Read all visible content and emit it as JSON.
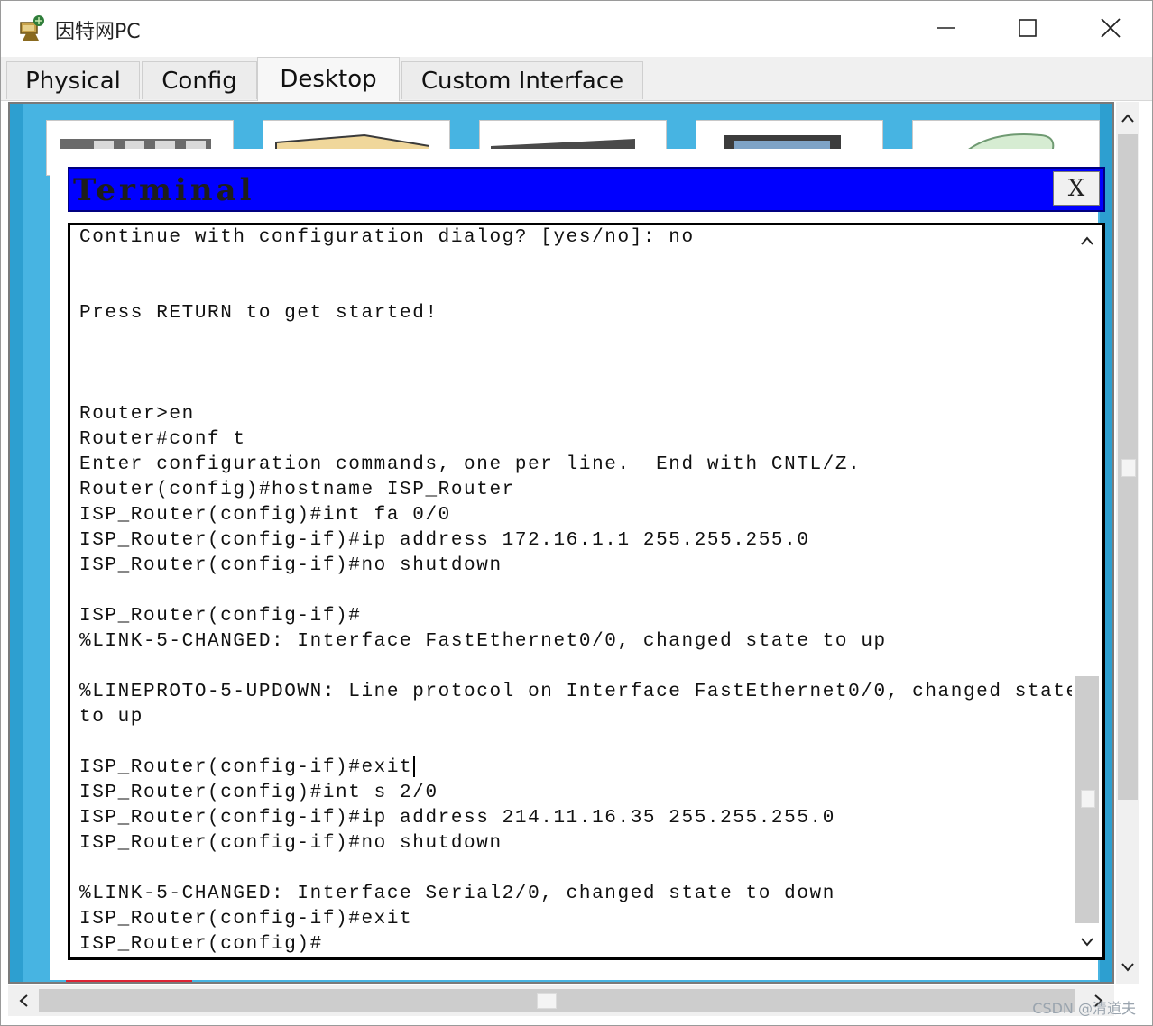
{
  "window": {
    "title": "因特网PC",
    "controls": {
      "minimize": "minimize-icon",
      "maximize": "maximize-icon",
      "close": "close-icon"
    }
  },
  "tabs": [
    {
      "label": "Physical",
      "active": false
    },
    {
      "label": "Config",
      "active": false
    },
    {
      "label": "Desktop",
      "active": true
    },
    {
      "label": "Custom Interface",
      "active": false
    }
  ],
  "terminal": {
    "title": "Terminal",
    "close_label": "X",
    "lines": [
      "Continue with configuration dialog? [yes/no]: no",
      "",
      "",
      "Press RETURN to get started!",
      "",
      "",
      "",
      "Router>en",
      "Router#conf t",
      "Enter configuration commands, one per line.  End with CNTL/Z.",
      "Router(config)#hostname ISP_Router",
      "ISP_Router(config)#int fa 0/0",
      "ISP_Router(config-if)#ip address 172.16.1.1 255.255.255.0",
      "ISP_Router(config-if)#no shutdown",
      "",
      "ISP_Router(config-if)#",
      "%LINK-5-CHANGED: Interface FastEthernet0/0, changed state to up",
      "",
      "%LINEPROTO-5-UPDOWN: Line protocol on Interface FastEthernet0/0, changed state",
      "to up",
      "",
      "ISP_Router(config-if)#exit",
      "ISP_Router(config)#int s 2/0",
      "ISP_Router(config-if)#ip address 214.11.16.35 255.255.255.0",
      "ISP_Router(config-if)#no shutdown",
      "",
      "%LINK-5-CHANGED: Interface Serial2/0, changed state to down",
      "ISP_Router(config-if)#exit",
      "ISP_Router(config)#"
    ],
    "cursor_line_index": 21
  },
  "watermark": "CSDN @清道夫",
  "colors": {
    "desktop_bg": "#47b4e2",
    "terminal_titlebar": "#0000ff",
    "terminal_bg": "#ffffff",
    "tab_active_bg": "#f7f7f7"
  }
}
